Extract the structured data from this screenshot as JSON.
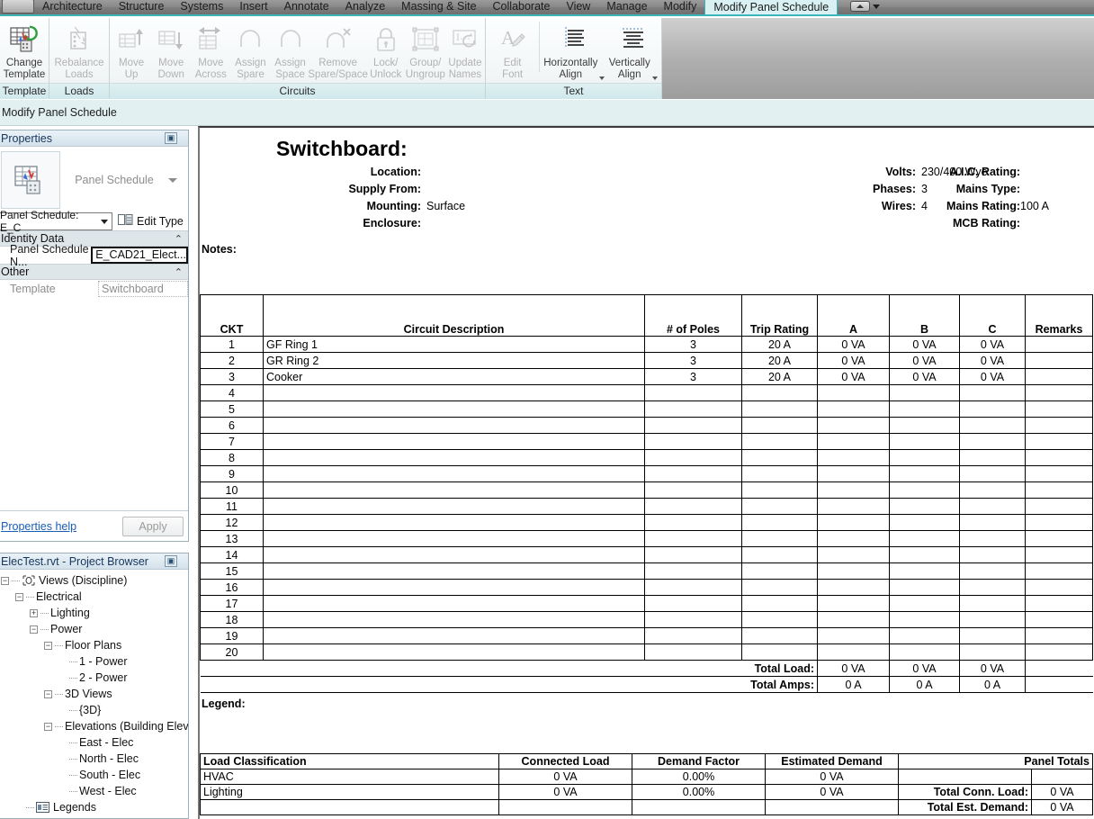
{
  "window": {
    "context_bar_label": "Modify Panel Schedule"
  },
  "ribbon": {
    "tabs": [
      {
        "label": "Architecture",
        "active": false
      },
      {
        "label": "Structure",
        "active": false
      },
      {
        "label": "Systems",
        "active": false
      },
      {
        "label": "Insert",
        "active": false
      },
      {
        "label": "Annotate",
        "active": false
      },
      {
        "label": "Analyze",
        "active": false
      },
      {
        "label": "Massing & Site",
        "active": false
      },
      {
        "label": "Collaborate",
        "active": false
      },
      {
        "label": "View",
        "active": false
      },
      {
        "label": "Manage",
        "active": false
      },
      {
        "label": "Modify",
        "active": false
      },
      {
        "label": "Modify Panel Schedule",
        "active": true
      }
    ],
    "panels": [
      {
        "title": "Template",
        "buttons": [
          {
            "label": "Change\nTemplate",
            "label1": "Change",
            "label2": "Template",
            "icon": "change-template-icon",
            "disabled": false,
            "dropdown": false
          }
        ]
      },
      {
        "title": "Loads",
        "buttons": [
          {
            "label1": "Rebalance",
            "label2": "Loads",
            "icon": "rebalance-loads-icon",
            "disabled": true,
            "dropdown": false
          }
        ]
      },
      {
        "title": "Circuits",
        "buttons": [
          {
            "label1": "Move",
            "label2": "Up",
            "icon": "move-up-icon",
            "disabled": true,
            "dropdown": false
          },
          {
            "label1": "Move",
            "label2": "Down",
            "icon": "move-down-icon",
            "disabled": true,
            "dropdown": false
          },
          {
            "label1": "Move",
            "label2": "Across",
            "icon": "move-across-icon",
            "disabled": true,
            "dropdown": false
          },
          {
            "label1": "Assign",
            "label2": "Spare",
            "icon": "assign-spare-icon",
            "disabled": true,
            "dropdown": false
          },
          {
            "label1": "Assign",
            "label2": "Space",
            "icon": "assign-space-icon",
            "disabled": true,
            "dropdown": false
          },
          {
            "label1": "Remove",
            "label2": "Spare/Space",
            "icon": "remove-spare-space-icon",
            "disabled": true,
            "dropdown": false
          },
          {
            "label1": "Lock/",
            "label2": "Unlock",
            "icon": "lock-unlock-icon",
            "disabled": true,
            "dropdown": false
          },
          {
            "label1": "Group/",
            "label2": "Ungroup",
            "icon": "group-ungroup-icon",
            "disabled": true,
            "dropdown": false
          },
          {
            "label1": "Update",
            "label2": "Names",
            "icon": "update-names-icon",
            "disabled": true,
            "dropdown": false
          }
        ]
      },
      {
        "title": "Text",
        "buttons": [
          {
            "label1": "Edit",
            "label2": "Font",
            "icon": "edit-font-icon",
            "disabled": true,
            "dropdown": false
          },
          {
            "label1": "Horizontally",
            "label2": "Align",
            "icon": "horizontal-align-icon",
            "disabled": false,
            "dropdown": true
          },
          {
            "label1": "Vertically",
            "label2": "Align",
            "icon": "vertical-align-icon",
            "disabled": false,
            "dropdown": true
          }
        ]
      }
    ]
  },
  "properties": {
    "title": "Properties",
    "type_name": "Panel Schedule",
    "selector_value": "Panel Schedule: E_C",
    "edit_type_label": "Edit Type",
    "groups": [
      {
        "name": "Identity Data",
        "rows": [
          {
            "key": "Panel Schedule N...",
            "value": "E_CAD21_Elect...",
            "focused": true,
            "greyed": false
          }
        ]
      },
      {
        "name": "Other",
        "rows": [
          {
            "key": "Template",
            "value": "Switchboard",
            "focused": false,
            "greyed": true
          }
        ]
      }
    ],
    "help_link": "Properties help",
    "apply_label": "Apply"
  },
  "browser": {
    "title": "ElecTest.rvt - Project Browser",
    "nodes": [
      {
        "label": "Views (Discipline)",
        "depth": 0,
        "toggle": "minus",
        "icon": "views-icon"
      },
      {
        "label": "Electrical",
        "depth": 1,
        "toggle": "minus",
        "icon": "none"
      },
      {
        "label": "Lighting",
        "depth": 2,
        "toggle": "plus",
        "icon": "none"
      },
      {
        "label": "Power",
        "depth": 2,
        "toggle": "minus",
        "icon": "none"
      },
      {
        "label": "Floor Plans",
        "depth": 3,
        "toggle": "minus",
        "icon": "none"
      },
      {
        "label": "1 - Power",
        "depth": 4,
        "toggle": "leaf",
        "icon": "none"
      },
      {
        "label": "2 - Power",
        "depth": 4,
        "toggle": "leaf",
        "icon": "none"
      },
      {
        "label": "3D Views",
        "depth": 3,
        "toggle": "minus",
        "icon": "none"
      },
      {
        "label": "{3D}",
        "depth": 4,
        "toggle": "leaf",
        "icon": "none"
      },
      {
        "label": "Elevations (Building Elev",
        "depth": 3,
        "toggle": "minus",
        "icon": "none"
      },
      {
        "label": "East - Elec",
        "depth": 4,
        "toggle": "leaf",
        "icon": "none"
      },
      {
        "label": "North - Elec",
        "depth": 4,
        "toggle": "leaf",
        "icon": "none"
      },
      {
        "label": "South - Elec",
        "depth": 4,
        "toggle": "leaf",
        "icon": "none"
      },
      {
        "label": "West - Elec",
        "depth": 4,
        "toggle": "leaf",
        "icon": "none"
      },
      {
        "label": "Legends",
        "depth": 1,
        "toggle": "leaf",
        "icon": "legend-icon"
      }
    ]
  },
  "schedule": {
    "title": "Switchboard:",
    "header_left": [
      {
        "label": "Location:",
        "value": ""
      },
      {
        "label": "Supply From:",
        "value": ""
      },
      {
        "label": "Mounting:",
        "value": "Surface"
      },
      {
        "label": "Enclosure:",
        "value": ""
      }
    ],
    "header_mid": [
      {
        "label": "Volts:",
        "value": "230/400 Wye"
      },
      {
        "label": "Phases:",
        "value": "3"
      },
      {
        "label": "Wires:",
        "value": "4"
      }
    ],
    "header_right": [
      {
        "label": "A.I.C. Rating:",
        "value": ""
      },
      {
        "label": "Mains Type:",
        "value": ""
      },
      {
        "label": "Mains Rating:",
        "value": "100 A"
      },
      {
        "label": "MCB Rating:",
        "value": ""
      }
    ],
    "notes_label": "Notes:",
    "legend_label": "Legend:",
    "columns": [
      "CKT",
      "Circuit Description",
      "# of Poles",
      "Trip Rating",
      "A",
      "B",
      "C",
      "Remarks"
    ],
    "rows": [
      {
        "ckt": "1",
        "desc": "GF Ring 1",
        "poles": "3",
        "trip": "20 A",
        "a": "0 VA",
        "b": "0 VA",
        "c": "0 VA",
        "remarks": ""
      },
      {
        "ckt": "2",
        "desc": "GR Ring 2",
        "poles": "3",
        "trip": "20 A",
        "a": "0 VA",
        "b": "0 VA",
        "c": "0 VA",
        "remarks": ""
      },
      {
        "ckt": "3",
        "desc": "Cooker",
        "poles": "3",
        "trip": "20 A",
        "a": "0 VA",
        "b": "0 VA",
        "c": "0 VA",
        "remarks": ""
      },
      {
        "ckt": "4",
        "desc": "",
        "poles": "",
        "trip": "",
        "a": "",
        "b": "",
        "c": "",
        "remarks": ""
      },
      {
        "ckt": "5",
        "desc": "",
        "poles": "",
        "trip": "",
        "a": "",
        "b": "",
        "c": "",
        "remarks": ""
      },
      {
        "ckt": "6",
        "desc": "",
        "poles": "",
        "trip": "",
        "a": "",
        "b": "",
        "c": "",
        "remarks": ""
      },
      {
        "ckt": "7",
        "desc": "",
        "poles": "",
        "trip": "",
        "a": "",
        "b": "",
        "c": "",
        "remarks": ""
      },
      {
        "ckt": "8",
        "desc": "",
        "poles": "",
        "trip": "",
        "a": "",
        "b": "",
        "c": "",
        "remarks": ""
      },
      {
        "ckt": "9",
        "desc": "",
        "poles": "",
        "trip": "",
        "a": "",
        "b": "",
        "c": "",
        "remarks": ""
      },
      {
        "ckt": "10",
        "desc": "",
        "poles": "",
        "trip": "",
        "a": "",
        "b": "",
        "c": "",
        "remarks": ""
      },
      {
        "ckt": "11",
        "desc": "",
        "poles": "",
        "trip": "",
        "a": "",
        "b": "",
        "c": "",
        "remarks": ""
      },
      {
        "ckt": "12",
        "desc": "",
        "poles": "",
        "trip": "",
        "a": "",
        "b": "",
        "c": "",
        "remarks": ""
      },
      {
        "ckt": "13",
        "desc": "",
        "poles": "",
        "trip": "",
        "a": "",
        "b": "",
        "c": "",
        "remarks": ""
      },
      {
        "ckt": "14",
        "desc": "",
        "poles": "",
        "trip": "",
        "a": "",
        "b": "",
        "c": "",
        "remarks": ""
      },
      {
        "ckt": "15",
        "desc": "",
        "poles": "",
        "trip": "",
        "a": "",
        "b": "",
        "c": "",
        "remarks": ""
      },
      {
        "ckt": "16",
        "desc": "",
        "poles": "",
        "trip": "",
        "a": "",
        "b": "",
        "c": "",
        "remarks": ""
      },
      {
        "ckt": "17",
        "desc": "",
        "poles": "",
        "trip": "",
        "a": "",
        "b": "",
        "c": "",
        "remarks": ""
      },
      {
        "ckt": "18",
        "desc": "",
        "poles": "",
        "trip": "",
        "a": "",
        "b": "",
        "c": "",
        "remarks": ""
      },
      {
        "ckt": "19",
        "desc": "",
        "poles": "",
        "trip": "",
        "a": "",
        "b": "",
        "c": "",
        "remarks": ""
      },
      {
        "ckt": "20",
        "desc": "",
        "poles": "",
        "trip": "",
        "a": "",
        "b": "",
        "c": "",
        "remarks": ""
      }
    ],
    "totals": [
      {
        "label": "Total Load:",
        "a": "0 VA",
        "b": "0 VA",
        "c": "0 VA"
      },
      {
        "label": "Total Amps:",
        "a": "0 A",
        "b": "0 A",
        "c": "0 A"
      }
    ],
    "load_classification": {
      "columns": [
        "Load Classification",
        "Connected Load",
        "Demand Factor",
        "Estimated Demand",
        "Panel Totals"
      ],
      "rows": [
        {
          "name": "HVAC",
          "connected": "0 VA",
          "factor": "0.00%",
          "estimated": "0 VA",
          "total_label": "",
          "total_value": ""
        },
        {
          "name": "Lighting",
          "connected": "0 VA",
          "factor": "0.00%",
          "estimated": "0 VA",
          "total_label": "Total Conn. Load:",
          "total_value": "0 VA"
        },
        {
          "name": "",
          "connected": "",
          "factor": "",
          "estimated": "",
          "total_label": "Total Est. Demand:",
          "total_value": "0 VA"
        }
      ]
    }
  },
  "colors": {
    "accent": "#3cb6bd",
    "active_tab_bg": "#d9f1f3",
    "panel_title_bg": "#dff0f2",
    "context_bar_bg": "#e3f0f1",
    "palette_title": "#17365d",
    "link": "#1a5fb4"
  }
}
